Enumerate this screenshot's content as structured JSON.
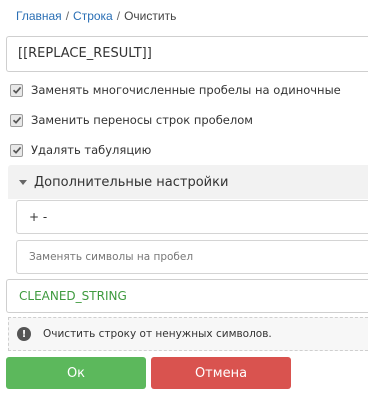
{
  "breadcrumb": {
    "items": [
      "Главная",
      "Строка"
    ],
    "separator": "/",
    "current": "Очистить"
  },
  "input": {
    "value": "[[REPLACE_RESULT]]"
  },
  "options": [
    {
      "label": "Заменять многочисленные пробелы на одиночные",
      "checked": true
    },
    {
      "label": "Заменить переносы строк пробелом",
      "checked": true
    },
    {
      "label": "Удалять табуляцию",
      "checked": true
    }
  ],
  "advanced": {
    "title": "Дополнительные настройки",
    "expanded": true,
    "chars_value": "+ -",
    "replace_placeholder": "Заменять символы на пробел"
  },
  "output": {
    "value": "CLEANED_STRING",
    "color": "#3e9a3e"
  },
  "hint": {
    "text": "Очистить строку от ненужных символов.",
    "icon": "info-icon"
  },
  "buttons": {
    "ok": {
      "label": "Ок",
      "color": "#5cb85c"
    },
    "cancel": {
      "label": "Отмена",
      "color": "#d9534f"
    }
  }
}
